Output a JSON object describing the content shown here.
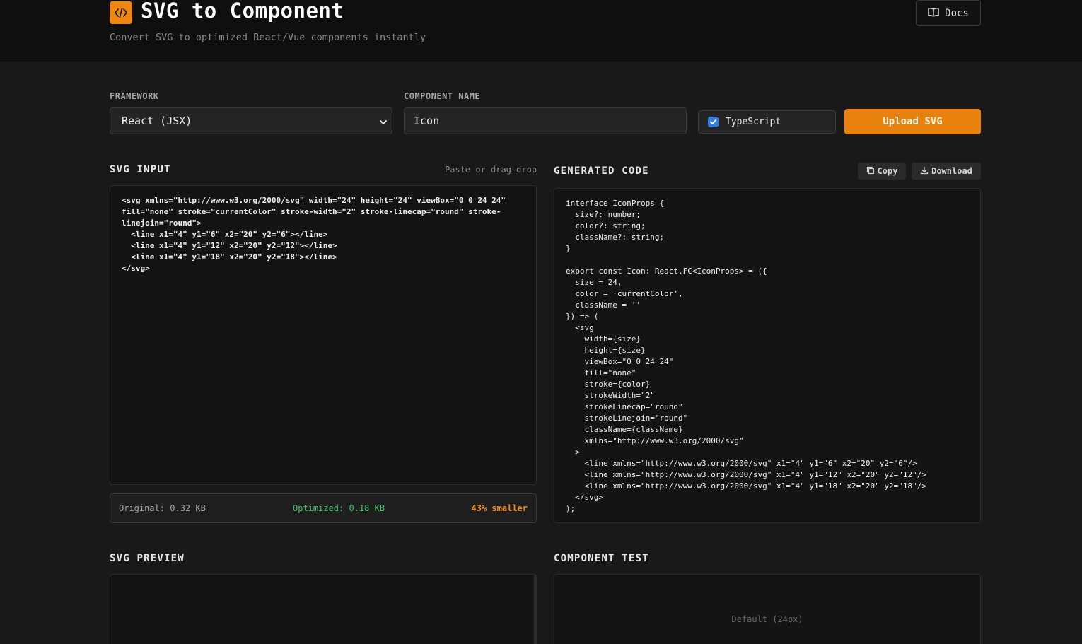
{
  "header": {
    "logo_glyph": "</>",
    "title": "SVG to Component",
    "subtitle": "Convert SVG to optimized React/Vue components instantly",
    "docs_label": "Docs"
  },
  "controls": {
    "framework_label": "FRAMEWORK",
    "framework_value": "React (JSX)",
    "component_name_label": "COMPONENT NAME",
    "component_name_value": "Icon",
    "typescript_label": "TypeScript",
    "typescript_checked": true,
    "upload_label": "Upload SVG"
  },
  "svg_input": {
    "title": "SVG INPUT",
    "hint": "Paste or drag-drop",
    "code": "<svg xmlns=\"http://www.w3.org/2000/svg\" width=\"24\" height=\"24\" viewBox=\"0 0 24 24\"\nfill=\"none\" stroke=\"currentColor\" stroke-width=\"2\" stroke-linecap=\"round\" stroke-\nlinejoin=\"round\">\n  <line x1=\"4\" y1=\"6\" x2=\"20\" y2=\"6\"></line>\n  <line x1=\"4\" y1=\"12\" x2=\"20\" y2=\"12\"></line>\n  <line x1=\"4\" y1=\"18\" x2=\"20\" y2=\"18\"></line>\n</svg>"
  },
  "stats": {
    "original": "Original: 0.32 KB",
    "optimized": "Optimized: 0.18 KB",
    "reduction": "43% smaller"
  },
  "generated": {
    "title": "GENERATED CODE",
    "copy_label": "Copy",
    "download_label": "Download",
    "code": "interface IconProps {\n  size?: number;\n  color?: string;\n  className?: string;\n}\n\nexport const Icon: React.FC<IconProps> = ({\n  size = 24,\n  color = 'currentColor',\n  className = ''\n}) => (\n  <svg\n    width={size}\n    height={size}\n    viewBox=\"0 0 24 24\"\n    fill=\"none\"\n    stroke={color}\n    strokeWidth=\"2\"\n    strokeLinecap=\"round\"\n    strokeLinejoin=\"round\"\n    className={className}\n    xmlns=\"http://www.w3.org/2000/svg\"\n  >\n    <line xmlns=\"http://www.w3.org/2000/svg\" x1=\"4\" y1=\"6\" x2=\"20\" y2=\"6\"/>\n    <line xmlns=\"http://www.w3.org/2000/svg\" x1=\"4\" y1=\"12\" x2=\"20\" y2=\"12\"/>\n    <line xmlns=\"http://www.w3.org/2000/svg\" x1=\"4\" y1=\"18\" x2=\"20\" y2=\"18\"/>\n  </svg>\n);"
  },
  "preview": {
    "svg_title": "SVG PREVIEW",
    "component_title": "COMPONENT TEST",
    "default_label": "Default (24px)"
  },
  "colors": {
    "accent": "#e8820c",
    "success": "#3ec76a",
    "checkbox": "#2f7de1"
  },
  "icons": {
    "logo": "code-brackets-icon",
    "docs": "book-icon",
    "copy": "copy-icon",
    "download": "download-icon",
    "select": "chevron-down-icon",
    "check": "check-icon"
  }
}
